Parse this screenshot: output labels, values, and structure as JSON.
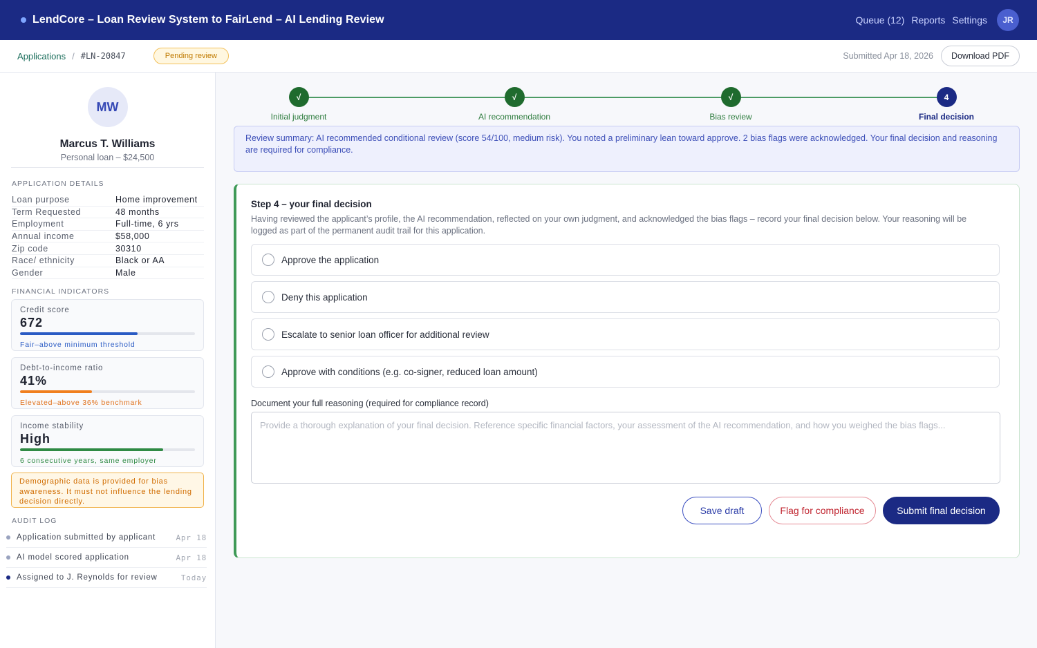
{
  "header": {
    "title": "LendCore – Loan Review System to FairLend – AI Lending Review",
    "nav": [
      "Queue (12)",
      "Reports",
      "Settings"
    ],
    "user_initials": "JR"
  },
  "subheader": {
    "breadcrumb_link": "Applications",
    "breadcrumb_sep": "/",
    "application_id": "#LN-20847",
    "status_badge": "Pending review",
    "submitted": "Submitted Apr 18, 2026",
    "download_label": "Download PDF"
  },
  "applicant": {
    "initials": "MW",
    "name": "Marcus T. Williams",
    "subtitle": "Personal loan – $24,500"
  },
  "application_details": {
    "title": "APPLICATION DETAILS",
    "rows": [
      {
        "label": "Loan purpose",
        "value": "Home improvement"
      },
      {
        "label": "Term Requested",
        "value": "48 months"
      },
      {
        "label": "Employment",
        "value": "Full-time, 6 yrs"
      },
      {
        "label": "Annual income",
        "value": "$58,000"
      },
      {
        "label": "Zip code",
        "value": "30310"
      },
      {
        "label": "Race/ ethnicity",
        "value": "Black or AA"
      },
      {
        "label": "Gender",
        "value": "Male"
      }
    ]
  },
  "financial_indicators": {
    "title": "FINANCIAL INDICATORS",
    "cards": [
      {
        "label": "Credit score",
        "value": "672",
        "level": 0.67,
        "color": "#2a5bc4",
        "note": "Fair–above minimum threshold",
        "note_color": "#2a5bc4"
      },
      {
        "label": "Debt-to-income ratio",
        "value": "41%",
        "level": 0.41,
        "color": "#f07f1e",
        "note": "Elevated–above 36% benchmark",
        "note_color": "#e0701a"
      },
      {
        "label": "Income stability",
        "value": "High",
        "level": 0.82,
        "color": "#2f8a44",
        "note": "6 consecutive years, same employer",
        "note_color": "#2f8a44"
      }
    ]
  },
  "bias_notice": "Demographic data is provided for bias awareness. It must not influence the lending decision directly.",
  "audit_log": {
    "title": "AUDIT LOG",
    "entries": [
      {
        "text": "Application submitted by applicant",
        "date": "Apr 18",
        "dot": "#9aa3bf"
      },
      {
        "text": "AI model scored application",
        "date": "Apr 18",
        "dot": "#9aa3bf"
      },
      {
        "text": "Assigned to J. Reynolds for review",
        "date": "Today",
        "dot": "#1b2a84"
      }
    ]
  },
  "stepper": {
    "steps": [
      {
        "label": "Initial judgment",
        "mark": "√",
        "state": "done"
      },
      {
        "label": "AI recommendation",
        "mark": "√",
        "state": "done"
      },
      {
        "label": "Bias review",
        "mark": "√",
        "state": "done"
      },
      {
        "label": "Final decision",
        "mark": "4",
        "state": "current"
      }
    ]
  },
  "summary": "Review summary: AI recommended conditional review (score 54/100, medium risk). You noted a preliminary lean toward approve. 2 bias flags were acknowledged. Your final decision and reasoning are required for compliance.",
  "decision": {
    "title": "Step 4 – your final decision",
    "description": "Having reviewed the applicant’s profile, the AI recommendation, reflected on your own judgment, and acknowledged the bias flags – record your final decision below. Your reasoning will be logged as part of the permanent audit trail for this application.",
    "options": [
      "Approve the application",
      "Deny this application",
      "Escalate to senior loan officer for additional review",
      "Approve with conditions (e.g. co-signer, reduced loan amount)"
    ],
    "reasoning_label": "Document your full reasoning (required for compliance record)",
    "reasoning_placeholder": "Provide a thorough explanation of your final decision. Reference specific financial factors, your assessment of the AI recommendation, and how you weighed the bias flags...",
    "reasoning_value": "",
    "buttons": {
      "save": "Save draft",
      "flag": "Flag for compliance",
      "submit": "Submit final decision"
    }
  },
  "colors": {
    "brand": "#1b2a84",
    "step_done": "#1f6b2e",
    "step_current": "#1b2a84"
  }
}
